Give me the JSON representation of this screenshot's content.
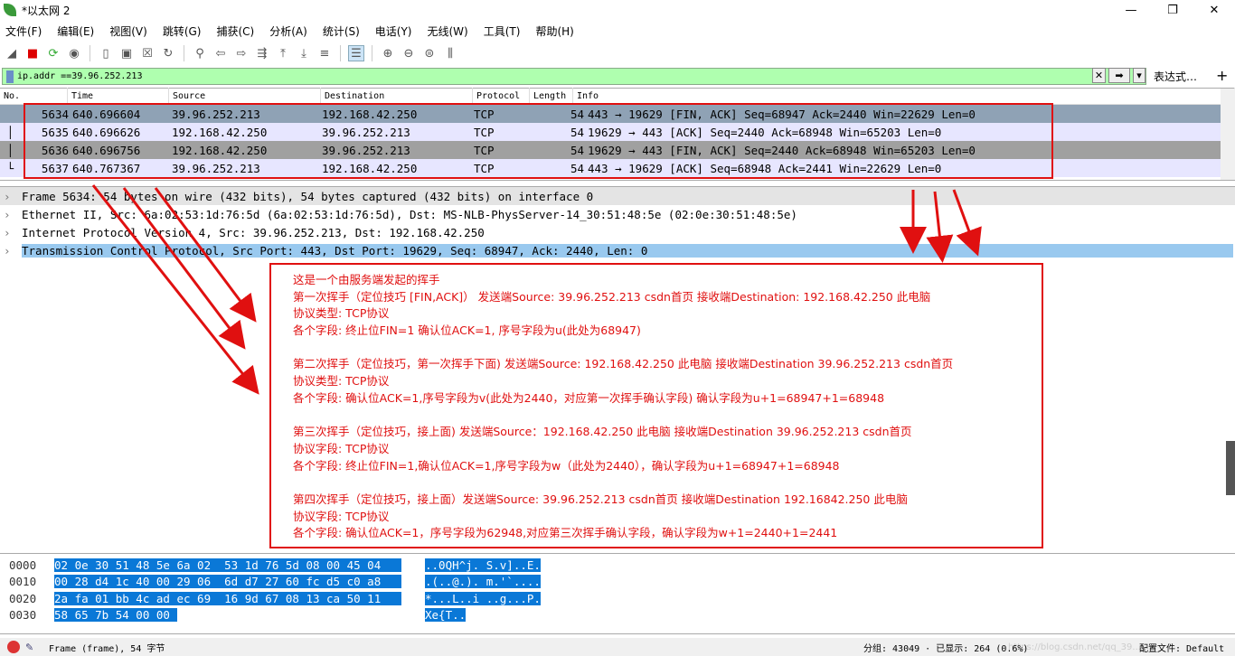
{
  "window": {
    "title": "*以太网 2",
    "minimize": "—",
    "maximize": "❐",
    "close": "✕"
  },
  "menu": [
    "文件(F)",
    "编辑(E)",
    "视图(V)",
    "跳转(G)",
    "捕获(C)",
    "分析(A)",
    "统计(S)",
    "电话(Y)",
    "无线(W)",
    "工具(T)",
    "帮助(H)"
  ],
  "toolbar_icons": [
    "shark-fin-start-icon",
    "stop-icon",
    "restart-icon",
    "options-icon",
    "open-icon",
    "save-icon",
    "close-file-icon",
    "reload-icon",
    "find-icon",
    "back-icon",
    "forward-icon",
    "goto-icon",
    "first-icon",
    "last-icon",
    "autoscroll-icon",
    "colorize-icon",
    "zoom-in-icon",
    "zoom-out-icon",
    "zoom-normal-icon",
    "resize-columns-icon"
  ],
  "filter": {
    "value": "ip.addr ==39.96.252.213",
    "clear": "✕",
    "apply": "➡",
    "dropdown": "▾",
    "expression_label": "表达式…",
    "add": "+"
  },
  "packet_list": {
    "columns": [
      "No.",
      "Time",
      "Source",
      "Destination",
      "Protocol",
      "Length",
      "Info"
    ],
    "rows": [
      {
        "no": "5634",
        "time": "640.696604",
        "src": "39.96.252.213",
        "dst": "192.168.42.250",
        "proto": "TCP",
        "len": "54",
        "info": "443 → 19629 [FIN, ACK] Seq=68947 Ack=2440 Win=22629 Len=0",
        "bg": "#8fa2b5"
      },
      {
        "no": "5635",
        "time": "640.696626",
        "src": "192.168.42.250",
        "dst": "39.96.252.213",
        "proto": "TCP",
        "len": "54",
        "info": "19629 → 443 [ACK] Seq=2440 Ack=68948 Win=65203 Len=0",
        "bg": "#e7e6ff"
      },
      {
        "no": "5636",
        "time": "640.696756",
        "src": "192.168.42.250",
        "dst": "39.96.252.213",
        "proto": "TCP",
        "len": "54",
        "info": "19629 → 443 [FIN, ACK] Seq=2440 Ack=68948 Win=65203 Len=0",
        "bg": "#a0a0a0"
      },
      {
        "no": "5637",
        "time": "640.767367",
        "src": "39.96.252.213",
        "dst": "192.168.42.250",
        "proto": "TCP",
        "len": "54",
        "info": "443 → 19629 [ACK] Seq=68948 Ack=2441 Win=22629 Len=0",
        "bg": "#e7e6ff"
      }
    ]
  },
  "details": [
    "Frame 5634: 54 bytes on wire (432 bits), 54 bytes captured (432 bits) on interface 0",
    "Ethernet II, Src: 6a:02:53:1d:76:5d (6a:02:53:1d:76:5d), Dst: MS-NLB-PhysServer-14_30:51:48:5e (02:0e:30:51:48:5e)",
    "Internet Protocol Version 4, Src: 39.96.252.213, Dst: 192.168.42.250",
    "Transmission Control Protocol, Src Port: 443, Dst Port: 19629, Seq: 68947, Ack: 2440, Len: 0"
  ],
  "annotation": [
    "这是一个由服务端发起的挥手",
    "第一次挥手（定位技巧 [FIN,ACK]） 发送端Source: 39.96.252.213 csdn首页   接收端Destination:  192.168.42.250 此电脑",
    "协议类型:   TCP协议",
    "各个字段:  终止位FIN=1 确认位ACK=1, 序号字段为u(此处为68947)",
    "",
    "第二次挥手（定位技巧，第一次挥手下面) 发送端Source: 192.168.42.250 此电脑  接收端Destination 39.96.252.213 csdn首页",
    "协议类型:   TCP协议",
    "各个字段: 确认位ACK=1,序号字段为v(此处为2440，对应第一次挥手确认字段) 确认字段为u+1=68947+1=68948",
    "",
    "第三次挥手（定位技巧，接上面) 发送端Source：192.168.42.250  此电脑       接收端Destination 39.96.252.213 csdn首页",
    "协议字段: TCP协议",
    "各个字段: 终止位FIN=1,确认位ACK=1,序号字段为w（此处为2440），确认字段为u+1=68947+1=68948",
    "",
    "第四次挥手（定位技巧，接上面）发送端Source: 39.96.252.213  csdn首页   接收端Destination 192.16842.250  此电脑",
    "协议字段: TCP协议",
    "各个字段: 确认位ACK=1，序号字段为62948,对应第三次挥手确认字段，确认字段为w+1=2440+1=2441"
  ],
  "bytes": [
    {
      "offset": "0000",
      "hex": "02 0e 30 51 48 5e 6a 02  53 1d 76 5d 08 00 45 04",
      "ascii": "..0QH^j. S.v]..E."
    },
    {
      "offset": "0010",
      "hex": "00 28 d4 1c 40 00 29 06  6d d7 27 60 fc d5 c0 a8",
      "ascii": ".(..@.). m.'`...."
    },
    {
      "offset": "0020",
      "hex": "2a fa 01 bb 4c ad ec 69  16 9d 67 08 13 ca 50 11",
      "ascii": "*...L..i ..g...P."
    },
    {
      "offset": "0030",
      "hex": "58 65 7b 54 00 00",
      "ascii": "Xe{T.."
    }
  ],
  "status": {
    "field": "Frame (frame), 54 字节",
    "packets": "分组: 43049 · 已显示: 264 (0.6%)",
    "profile": "配置文件: Default",
    "watermark": "https://blog.csdn.net/qq_39..."
  },
  "colors": {
    "accent_red": "#e01010",
    "selection_blue": "#0a78d7",
    "filter_green": "#afffaf"
  }
}
